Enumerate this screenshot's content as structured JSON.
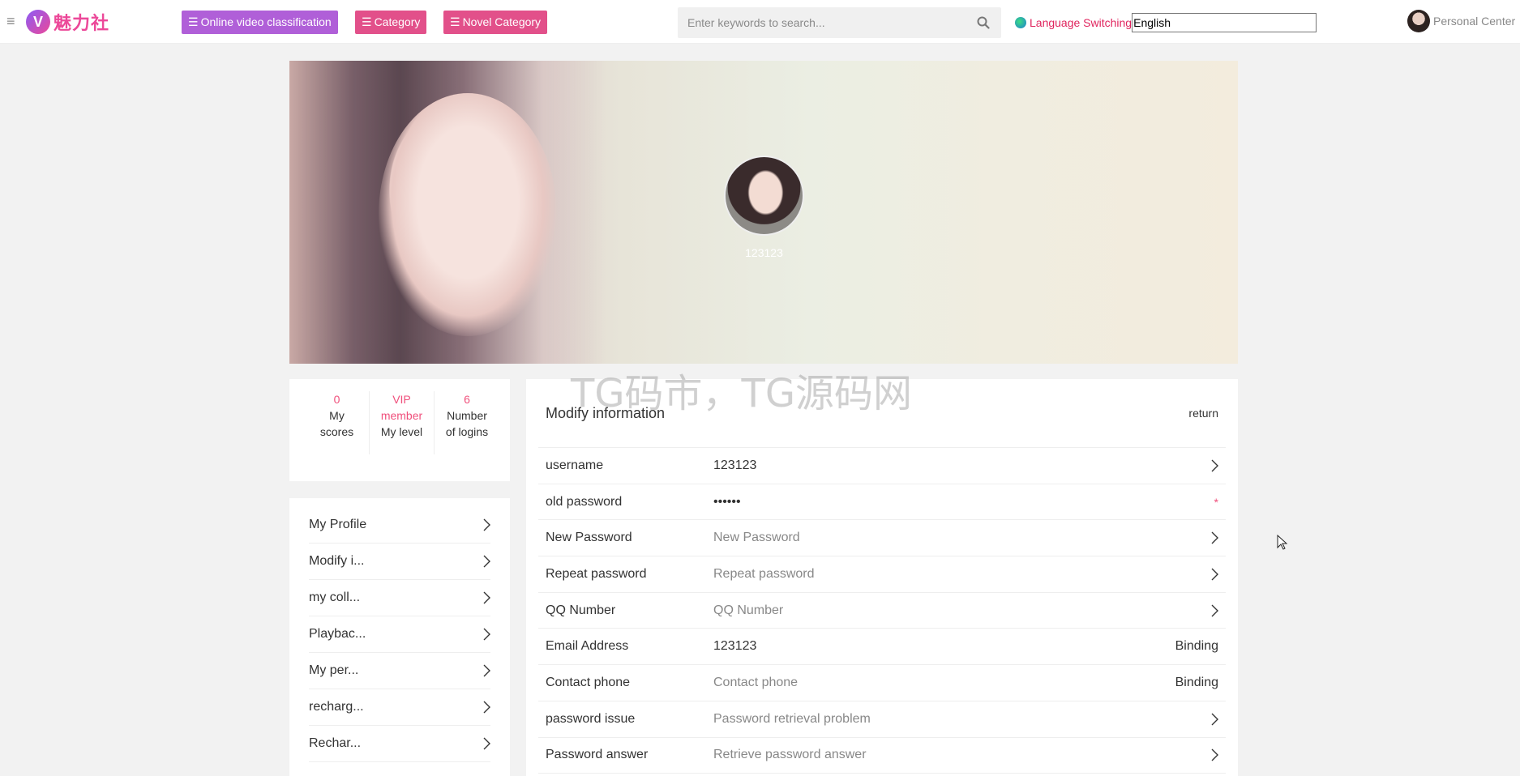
{
  "header": {
    "logo_letter": "V",
    "logo_text": "魅力社",
    "nav": [
      {
        "label": "Online video classification",
        "color": "#b05fd8"
      },
      {
        "label": "Category",
        "color": "#e2508a"
      },
      {
        "label": "Novel Category",
        "color": "#e2508a"
      }
    ],
    "search_placeholder": "Enter keywords to search...",
    "language_label": "Language Switching",
    "language_value": "English",
    "personal_center": "Personal Center"
  },
  "banner": {
    "username": "123123"
  },
  "watermark": "TG码市，TG源码网",
  "stats": [
    {
      "value": "0",
      "line1": "My",
      "line2": "scores"
    },
    {
      "value": "VIP",
      "line1": "member",
      "line2": "My level"
    },
    {
      "value": "6",
      "line1": "Number",
      "line2": "of logins"
    }
  ],
  "side_menu": [
    "My Profile",
    "Modify i...",
    "my coll...",
    "Playbac...",
    "My per...",
    "recharg...",
    "Rechar..."
  ],
  "form": {
    "title": "Modify information",
    "return_label": "return",
    "rows": [
      {
        "label": "username",
        "value": "123123",
        "placeholder": "",
        "trail": ""
      },
      {
        "label": "old password",
        "value": "••••••",
        "placeholder": "",
        "trail": "*"
      },
      {
        "label": "New Password",
        "value": "",
        "placeholder": "New Password",
        "trail": ""
      },
      {
        "label": "Repeat password",
        "value": "",
        "placeholder": "Repeat password",
        "trail": ""
      },
      {
        "label": "QQ Number",
        "value": "",
        "placeholder": "QQ Number",
        "trail": ""
      },
      {
        "label": "Email Address",
        "value": "123123",
        "placeholder": "",
        "trail": "Binding"
      },
      {
        "label": "Contact phone",
        "value": "",
        "placeholder": "Contact phone",
        "trail": "Binding"
      },
      {
        "label": "password issue",
        "value": "",
        "placeholder": "Password retrieval problem",
        "trail": ""
      },
      {
        "label": "Password answer",
        "value": "",
        "placeholder": "Retrieve password answer",
        "trail": ""
      }
    ]
  },
  "colors": {
    "accent": "#f0507c",
    "nav_purple": "#b05fd8",
    "nav_pink": "#e2508a",
    "language_red": "#e0245e"
  }
}
